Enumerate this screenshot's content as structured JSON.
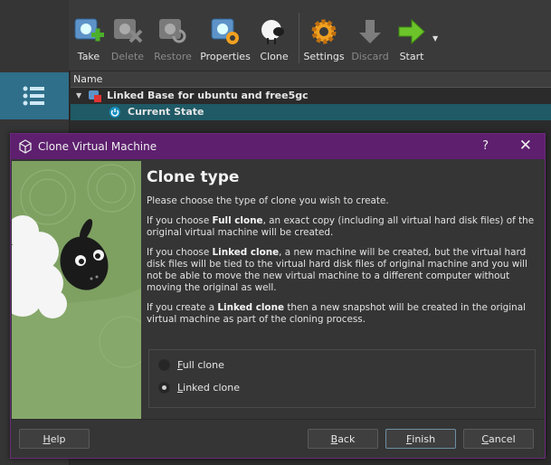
{
  "toolbar": {
    "items": [
      {
        "label": "Take",
        "icon": "take-snapshot-icon"
      },
      {
        "label": "Delete",
        "icon": "delete-snapshot-icon"
      },
      {
        "label": "Restore",
        "icon": "restore-snapshot-icon"
      },
      {
        "label": "Properties",
        "icon": "properties-icon"
      },
      {
        "label": "Clone",
        "icon": "clone-sheep-icon"
      },
      {
        "label": "Settings",
        "icon": "settings-gear-icon"
      },
      {
        "label": "Discard",
        "icon": "discard-arrow-icon"
      },
      {
        "label": "Start",
        "icon": "start-arrow-icon"
      }
    ]
  },
  "tree": {
    "header": "Name",
    "vm_name": "Linked Base for ubuntu and free5gc",
    "current_state": "Current State"
  },
  "dialog": {
    "title": "Clone Virtual Machine",
    "help_glyph": "?",
    "close_glyph": "✕",
    "heading": "Clone type",
    "intro": "Please choose the type of clone you wish to create.",
    "full_p1": "If you choose ",
    "full_bold": "Full clone",
    "full_p2": ", an exact copy (including all virtual hard disk files) of the original virtual machine will be created.",
    "linked_p1": "If you choose ",
    "linked_bold": "Linked clone",
    "linked_p2": ", a new machine will be created, but the virtual hard disk files will be tied to the virtual hard disk files of original machine and you will not be able to move the new virtual machine to a different computer without moving the original as well.",
    "snap_p1": "If you create a ",
    "snap_bold": "Linked clone",
    "snap_p2": " then a new snapshot will be created in the original virtual machine as part of the cloning process.",
    "options": [
      {
        "mnemonic": "F",
        "rest": "ull clone",
        "checked": false
      },
      {
        "mnemonic": "L",
        "rest": "inked clone",
        "checked": true
      }
    ],
    "buttons": {
      "help": {
        "mnemonic": "H",
        "rest": "elp"
      },
      "back": {
        "mnemonic": "B",
        "rest": "ack"
      },
      "finish": {
        "mnemonic": "F",
        "rest": "inish"
      },
      "cancel": {
        "mnemonic": "C",
        "rest": "ancel"
      }
    }
  },
  "colors": {
    "title_bar": "#5d1f6e",
    "selection": "#1f5a66",
    "tools_button": "#2f6f8a",
    "art_green": "#86a86a"
  }
}
